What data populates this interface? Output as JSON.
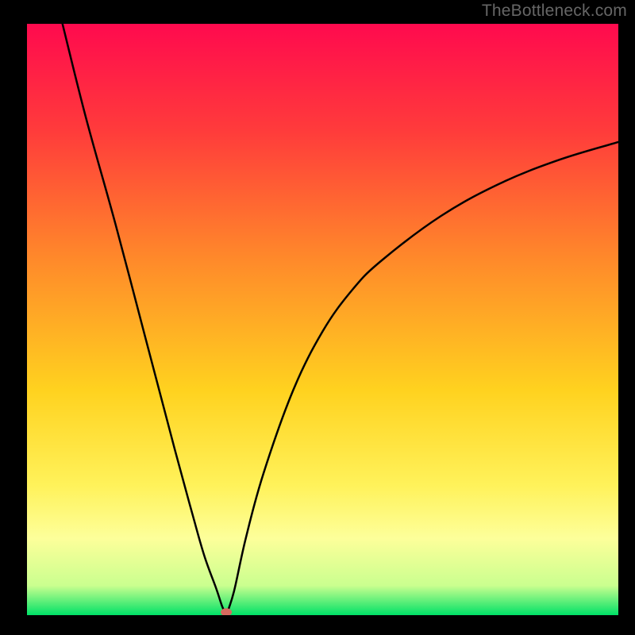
{
  "watermark": "TheBottleneck.com",
  "colors": {
    "background_black": "#000000",
    "gradient_top": "#ff0a4e",
    "gradient_mid1": "#ff3b3b",
    "gradient_mid2": "#ff8a2a",
    "gradient_mid3": "#ffd21f",
    "gradient_mid4": "#fff25a",
    "gradient_band": "#fdff9a",
    "gradient_bottom": "#00e167",
    "curve": "#000000",
    "marker": "#d76a5f"
  },
  "chart_data": {
    "type": "line",
    "title": "",
    "xlabel": "",
    "ylabel": "",
    "xlim": [
      0,
      100
    ],
    "ylim": [
      0,
      100
    ],
    "grid": false,
    "legend": false,
    "series": [
      {
        "name": "left-branch",
        "x": [
          6,
          10,
          15,
          20,
          25,
          28,
          30,
          32,
          33,
          33.7
        ],
        "y": [
          100,
          84,
          66,
          47,
          28,
          17,
          10,
          4.5,
          1.5,
          0
        ]
      },
      {
        "name": "right-branch",
        "x": [
          33.7,
          35,
          37,
          40,
          45,
          50,
          55,
          60,
          70,
          80,
          90,
          100
        ],
        "y": [
          0,
          4,
          13,
          24,
          38,
          48,
          55,
          60,
          67.5,
          73,
          77,
          80
        ]
      }
    ],
    "marker": {
      "x": 33.7,
      "y": 0.5,
      "color": "#d76a5f"
    },
    "background_gradient": {
      "0.00": "#ff0a4e",
      "0.18": "#ff3b3b",
      "0.40": "#ff8a2a",
      "0.62": "#ffd21f",
      "0.78": "#fff25a",
      "0.87": "#fdff9a",
      "0.95": "#caff8f",
      "1.00": "#00e167"
    }
  }
}
